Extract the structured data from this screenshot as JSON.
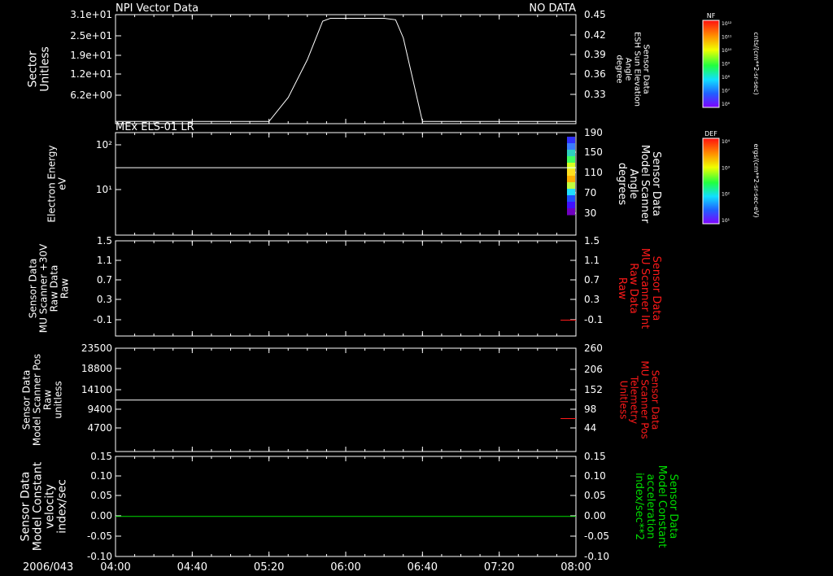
{
  "colors": {
    "background": "#000000",
    "axis": "#ffffff",
    "red": "#ff1a1a",
    "green": "#00dd00"
  },
  "header": {
    "left_title": "NPI Vector Data",
    "right_title": "NO DATA"
  },
  "time_axis": {
    "date": "2006/043",
    "ticks": [
      "04:00",
      "04:40",
      "05:20",
      "06:00",
      "06:40",
      "07:20",
      "08:00"
    ],
    "range": [
      "04:00",
      "08:00"
    ]
  },
  "colorbars": [
    {
      "label": "NF",
      "unit": "cnts/(cm**2-sr-sec)",
      "tick_labels": [
        "10¹²",
        "10¹¹",
        "10¹⁰",
        "10⁹",
        "10⁸",
        "10⁷",
        "10⁶"
      ]
    },
    {
      "label": "DEF",
      "unit": "ergs/(cm**2-sr-sec-eV)",
      "tick_labels": [
        "10⁴",
        "10³",
        "10²",
        "10¹"
      ]
    }
  ],
  "chart_data": [
    {
      "type": "line",
      "panel_title": "",
      "ylabel_left": [
        "Sector",
        "Unitless"
      ],
      "yticks_left": [
        "3.1e+01",
        "2.5e+01",
        "1.9e+01",
        "1.2e+01",
        "6.2e+00"
      ],
      "ylabel_right": [
        "Sensor Data",
        "ESH Sun Elevation",
        "Angle",
        "degree"
      ],
      "yticks_right": [
        "0.45",
        "0.42",
        "0.39",
        "0.36",
        "0.33"
      ],
      "ylim_right": [
        0.3,
        0.45
      ],
      "series": [
        {
          "color": "#ffffff",
          "x": [
            "04:00",
            "05:20",
            "05:30",
            "05:40",
            "05:48",
            "05:52",
            "06:00",
            "06:10",
            "06:20",
            "06:26",
            "06:30",
            "06:40",
            "08:00"
          ],
          "y": [
            0.303,
            0.303,
            0.336,
            0.388,
            0.441,
            0.445,
            0.445,
            0.445,
            0.445,
            0.443,
            0.418,
            0.303,
            0.303
          ]
        }
      ]
    },
    {
      "type": "heatmap",
      "panel_title": "MEx ELS-01 LR",
      "ylabel_left": [
        "Electron Energy",
        "eV"
      ],
      "yticks_left": [
        "10²",
        "10¹"
      ],
      "yscale_left": "log",
      "ylabel_right": [
        "Sensor Data",
        "Model Scanner",
        "Angle",
        "degrees"
      ],
      "yticks_right": [
        "190",
        "150",
        "110",
        "70",
        "30"
      ],
      "ylim_right": [
        0,
        190
      ],
      "series": [
        {
          "color": "#ffffff",
          "x": [
            "04:00",
            "08:00"
          ],
          "y": [
            125,
            125
          ]
        }
      ],
      "heatmap_note": "spectrogram data present only near 08:00"
    },
    {
      "type": "line",
      "panel_title": "",
      "ylabel_left": [
        "Sensor Data",
        "MU Scanner +30V",
        "Raw Data",
        "Raw"
      ],
      "yticks_left": [
        "1.5",
        "1.1",
        "0.7",
        "0.3",
        "-0.1"
      ],
      "ylim_left": [
        -0.3,
        1.5
      ],
      "ylabel_right": [
        "Sensor Data",
        "MU Scanner Int",
        "Raw Data",
        "Raw"
      ],
      "yticks_right": [
        "1.5",
        "1.1",
        "0.7",
        "0.3",
        "-0.1"
      ],
      "ylim_right": [
        -0.3,
        1.5
      ],
      "series": [
        {
          "color": "#ff1a1a",
          "x": [
            "07:52",
            "08:00"
          ],
          "y": [
            0.0,
            0.0
          ]
        }
      ]
    },
    {
      "type": "line",
      "panel_title": "",
      "ylabel_left": [
        "Sensor Data",
        "Model Scanner Pos",
        "Raw",
        "unitless"
      ],
      "yticks_left": [
        "23500",
        "18800",
        "14100",
        "9400",
        "4700"
      ],
      "ylim_left": [
        0,
        23500
      ],
      "ylabel_right": [
        "Sensor Data",
        "MU Scanner Pos",
        "Telemetry",
        "Unitless"
      ],
      "yticks_right": [
        "260",
        "206",
        "152",
        "98",
        "44"
      ],
      "ylim_right": [
        -10,
        260
      ],
      "series": [
        {
          "color": "#ffffff",
          "axis": "left",
          "x": [
            "04:00",
            "08:00"
          ],
          "y": [
            11700,
            11700
          ]
        },
        {
          "color": "#ff1a1a",
          "axis": "right",
          "x": [
            "07:52",
            "08:00"
          ],
          "y": [
            76,
            76
          ]
        }
      ]
    },
    {
      "type": "line",
      "panel_title": "",
      "ylabel_left": [
        "Sensor Data",
        "Model Constant",
        "velocity",
        "index/sec"
      ],
      "yticks_left": [
        "0.15",
        "0.10",
        "0.05",
        "0.00",
        "-0.05",
        "-0.10"
      ],
      "ylim_left": [
        -0.1,
        0.15
      ],
      "ylabel_right": [
        "Sensor Data",
        "Model Constant",
        "acceleration",
        "index/sec**2"
      ],
      "yticks_right": [
        "0.15",
        "0.10",
        "0.05",
        "0.00",
        "-0.05",
        "-0.10"
      ],
      "ylim_right": [
        -0.1,
        0.15
      ],
      "series": [
        {
          "color": "#00dd00",
          "x": [
            "04:00",
            "08:00"
          ],
          "y": [
            0.0,
            0.0
          ]
        }
      ]
    }
  ]
}
